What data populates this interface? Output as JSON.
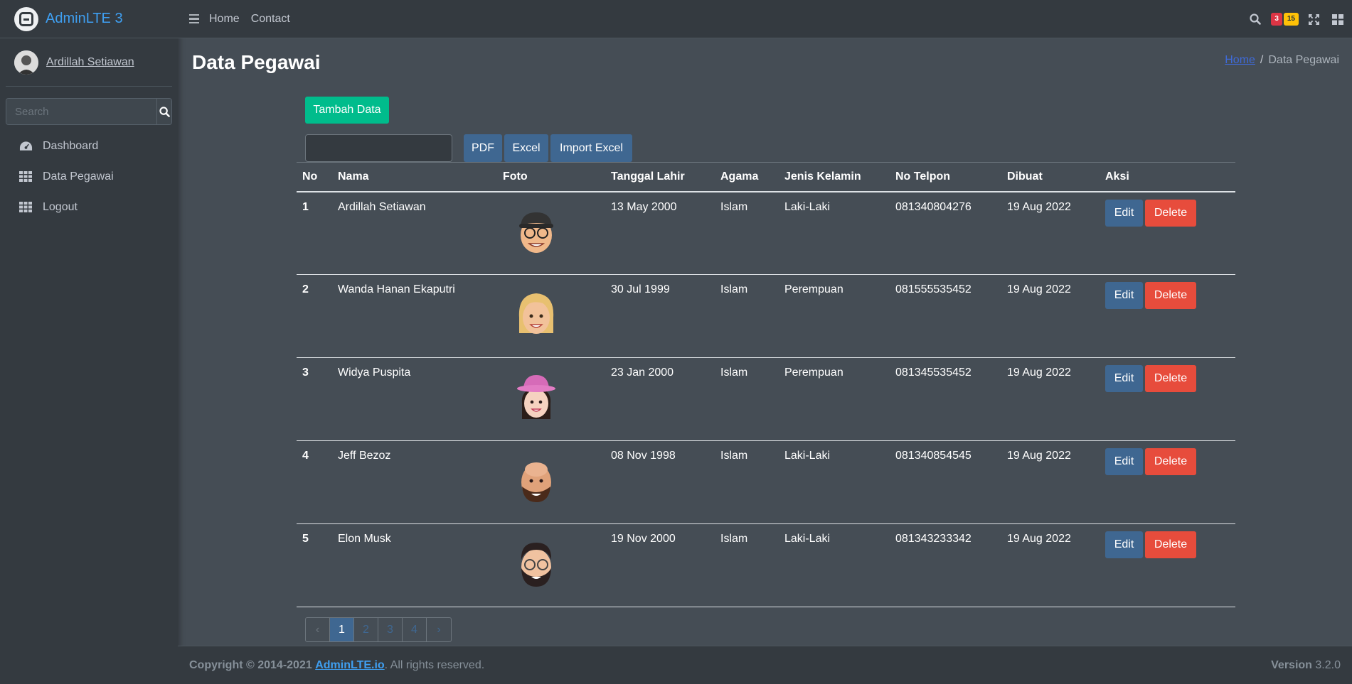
{
  "brand": {
    "name": "AdminLTE 3"
  },
  "user": {
    "name": "Ardillah Setiawan"
  },
  "sidebar": {
    "search_placeholder": "Search",
    "items": [
      {
        "label": "Dashboard",
        "icon": "dashboard-icon"
      },
      {
        "label": "Data Pegawai",
        "icon": "grid-icon"
      },
      {
        "label": "Logout",
        "icon": "grid-icon"
      }
    ]
  },
  "topbar": {
    "links": [
      "Home",
      "Contact"
    ],
    "badge_red": "3",
    "badge_yellow": "15"
  },
  "page": {
    "title": "Data Pegawai",
    "breadcrumb": [
      "Home",
      "Data Pegawai"
    ]
  },
  "toolbar": {
    "add_label": "Tambah Data",
    "pdf_label": "PDF",
    "excel_label": "Excel",
    "import_label": "Import Excel"
  },
  "table": {
    "headers": [
      "No",
      "Nama",
      "Foto",
      "Tanggal Lahir",
      "Agama",
      "Jenis Kelamin",
      "No Telpon",
      "Dibuat",
      "Aksi"
    ],
    "edit_label": "Edit",
    "delete_label": "Delete",
    "rows": [
      {
        "no": "1",
        "nama": "Ardillah Setiawan",
        "tanggal_lahir": "13 May 2000",
        "agama": "Islam",
        "jenis_kelamin": "Laki-Laki",
        "no_telpon": "081340804276",
        "dibuat": "19 Aug 2022"
      },
      {
        "no": "2",
        "nama": "Wanda Hanan Ekaputri",
        "tanggal_lahir": "30 Jul 1999",
        "agama": "Islam",
        "jenis_kelamin": "Perempuan",
        "no_telpon": "081555535452",
        "dibuat": "19 Aug 2022"
      },
      {
        "no": "3",
        "nama": "Widya Puspita",
        "tanggal_lahir": "23 Jan 2000",
        "agama": "Islam",
        "jenis_kelamin": "Perempuan",
        "no_telpon": "081345535452",
        "dibuat": "19 Aug 2022"
      },
      {
        "no": "4",
        "nama": "Jeff Bezoz",
        "tanggal_lahir": "08 Nov 1998",
        "agama": "Islam",
        "jenis_kelamin": "Laki-Laki",
        "no_telpon": "081340854545",
        "dibuat": "19 Aug 2022"
      },
      {
        "no": "5",
        "nama": "Elon Musk",
        "tanggal_lahir": "19 Nov 2000",
        "agama": "Islam",
        "jenis_kelamin": "Laki-Laki",
        "no_telpon": "081343233342",
        "dibuat": "19 Aug 2022"
      }
    ]
  },
  "pagination": {
    "prev": "‹",
    "pages": [
      "1",
      "2",
      "3",
      "4"
    ],
    "next": "›",
    "active": "1"
  },
  "footer": {
    "copyright": "Copyright © 2014-2021",
    "link": "AdminLTE.io",
    "rights": ". All rights reserved.",
    "version_label": "Version",
    "version": "3.2.0"
  },
  "colors": {
    "accent_green": "#00bc8c",
    "accent_blue": "#3f6791",
    "danger": "#e74c3c",
    "bg_dark": "#343a40",
    "bg_content": "#454d55"
  }
}
